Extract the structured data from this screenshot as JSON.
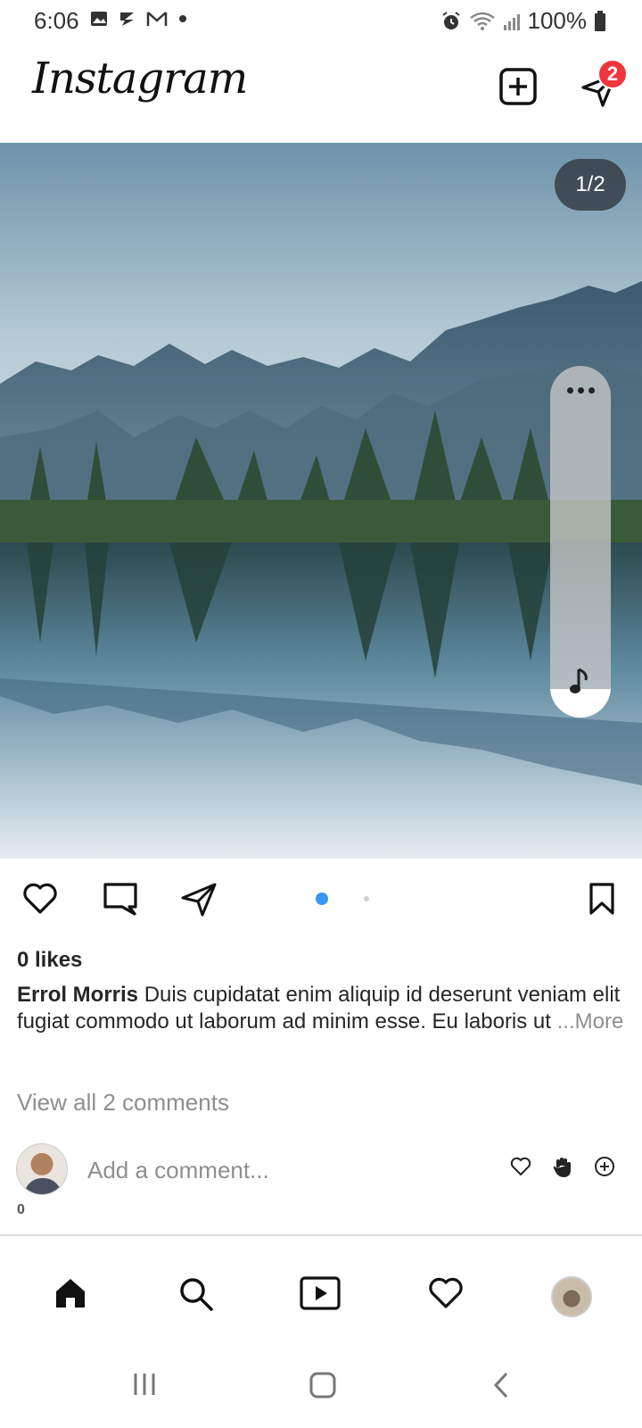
{
  "status_bar": {
    "time": "6:06",
    "battery": "100%",
    "icons": [
      "image-icon",
      "sync-icon",
      "gmail-icon",
      "dot-icon",
      "alarm-icon",
      "wifi-icon",
      "signal-icon",
      "battery-icon"
    ]
  },
  "header": {
    "logo": "Instagram",
    "dm_badge_count": "2"
  },
  "post": {
    "counter": "1/2",
    "carousel_index": 1,
    "carousel_total": 2,
    "likes": "0 likes",
    "author": "Errol Morris",
    "caption_text": "Duis cupidatat enim aliquip id deserunt veniam elit fugiat commodo ut laborum ad minim esse. Eu laboris ut",
    "more_label": "...More",
    "view_comments": "View all 2 comments"
  },
  "comment_box": {
    "placeholder": "Add a comment...",
    "count": "0",
    "quick_reactions": [
      "heart-icon",
      "raised-hand-icon",
      "add-reaction-icon"
    ]
  },
  "bottom_nav": {
    "items": [
      "home-icon",
      "search-icon",
      "reels-icon",
      "activity-heart-icon",
      "profile-avatar"
    ]
  },
  "colors": {
    "accent_blue": "#3897f0",
    "badge_red": "#f0353f",
    "muted_text": "#8e8e8e"
  }
}
